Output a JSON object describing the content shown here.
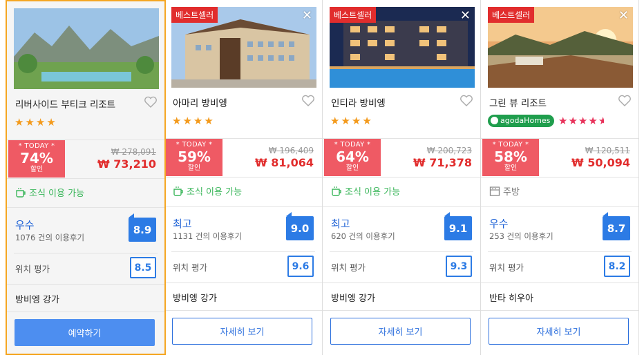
{
  "cards": [
    {
      "badge": "",
      "name": "리버사이드 부티크 리조트",
      "stars": 4,
      "deal_label": "* TODAY *",
      "discount": "74%",
      "discount_label": "할인",
      "orig_price": "₩ 278,091",
      "price": "₩ 73,210",
      "amenity": "조식 이용 가능",
      "rating_word": "우수",
      "review_count": "1076 건의 이용후기",
      "score": "8.9",
      "location_label": "위치 평가",
      "location_score": "8.5",
      "area": "방비엥 강가",
      "button": "예약하기"
    },
    {
      "badge": "베스트셀러",
      "name": "아마리 방비엥",
      "stars": 4,
      "deal_label": "* TODAY *",
      "discount": "59%",
      "discount_label": "할인",
      "orig_price": "₩ 196,409",
      "price": "₩ 81,064",
      "amenity": "조식 이용 가능",
      "rating_word": "최고",
      "review_count": "1131 건의 이용후기",
      "score": "9.0",
      "location_label": "위치 평가",
      "location_score": "9.6",
      "area": "방비엥 강가",
      "button": "자세히 보기"
    },
    {
      "badge": "베스트셀러",
      "name": "인티라 방비엥",
      "stars": 4,
      "deal_label": "* TODAY *",
      "discount": "64%",
      "discount_label": "할인",
      "orig_price": "₩ 200,723",
      "price": "₩ 71,378",
      "amenity": "조식 이용 가능",
      "rating_word": "최고",
      "review_count": "620 건의 이용후기",
      "score": "9.1",
      "location_label": "위치 평가",
      "location_score": "9.3",
      "area": "방비엥 강가",
      "button": "자세히 보기"
    },
    {
      "badge": "베스트셀러",
      "name": "그린 뷰 리조트",
      "stars": 4.5,
      "tag": "agodaHomes",
      "deal_label": "* TODAY *",
      "discount": "58%",
      "discount_label": "할인",
      "orig_price": "₩ 120,511",
      "price": "₩ 50,094",
      "amenity": "주방",
      "rating_word": "우수",
      "review_count": "253 건의 이용후기",
      "score": "8.7",
      "location_label": "위치 평가",
      "location_score": "8.2",
      "area": "반타 히우아",
      "button": "자세히 보기"
    }
  ],
  "colors": {
    "accent": "#2c7be5",
    "sale": "#ef5a64",
    "price": "#e12d2d",
    "amenity": "#3ab65a",
    "selected_border": "#f5a623"
  }
}
